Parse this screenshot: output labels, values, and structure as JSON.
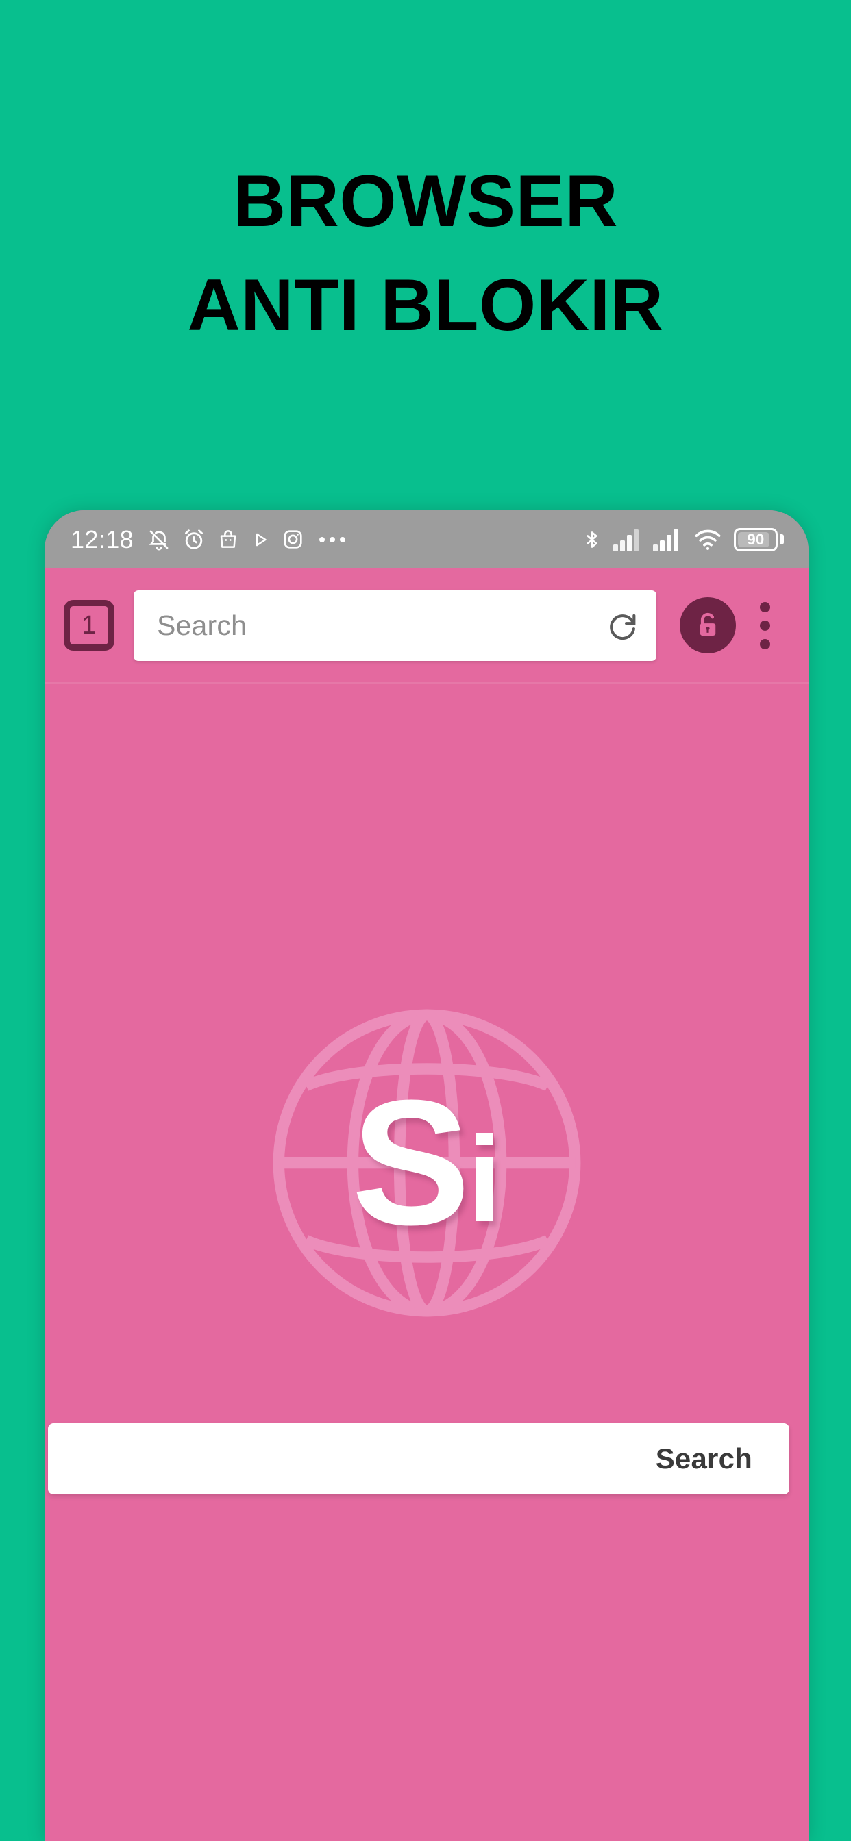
{
  "promo": {
    "headline_line1": "BROWSER",
    "headline_line2": "ANTI BLOKIR",
    "background_color": "#08bf8e",
    "text_color": "#000000"
  },
  "phone": {
    "status_bar": {
      "background_color": "#9d9d9d",
      "clock": "12:18",
      "left_icons": [
        "notification-bell-off-icon",
        "alarm-clock-icon",
        "shopping-bag-icon",
        "play-store-icon",
        "instagram-icon",
        "more-notifications-icon"
      ],
      "right_icons": [
        "bluetooth-icon",
        "cellular-signal-sim1-icon",
        "cellular-signal-sim2-icon",
        "wifi-icon"
      ],
      "battery_level": "90"
    },
    "browser": {
      "toolbar": {
        "background_color": "#e4699f",
        "accent_color": "#6e2345",
        "tab_count": "1",
        "omnibox_placeholder": "Search",
        "reload_label": "reload-icon",
        "lock_label": "unlock-icon",
        "menu_label": "overflow-menu-icon"
      },
      "page": {
        "background_color": "#e4699f",
        "logo_letters_main": "S",
        "logo_letters_sub": "i",
        "logo_watermark": "globe-icon",
        "search_button_label": "Search"
      }
    }
  }
}
